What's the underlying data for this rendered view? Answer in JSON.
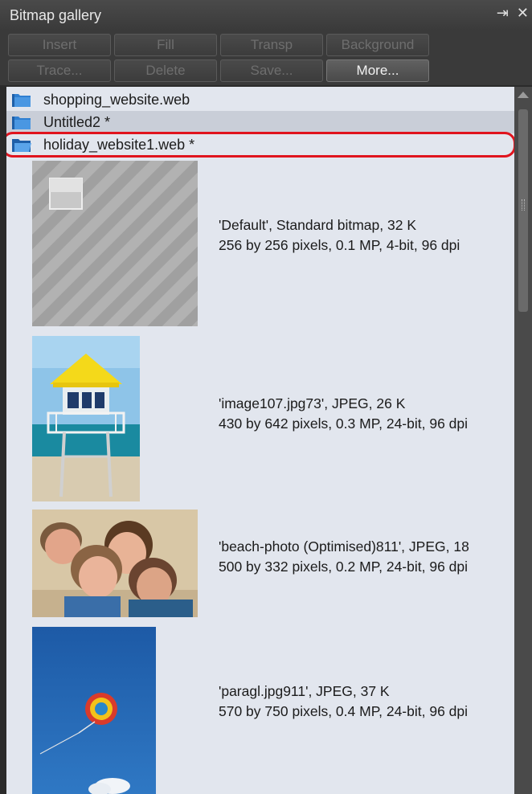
{
  "window": {
    "title": "Bitmap gallery"
  },
  "toolbar": {
    "row1": [
      "Insert",
      "Fill",
      "Transp",
      "Background"
    ],
    "row2": [
      "Trace...",
      "Delete",
      "Save...",
      "More..."
    ]
  },
  "folders": [
    {
      "name": "shopping_website.web"
    },
    {
      "name": "Untitled2 *"
    },
    {
      "name": "holiday_website1.web *"
    }
  ],
  "bitmaps": [
    {
      "line1": "'Default',  Standard bitmap,  32 K",
      "line2": "256 by 256 pixels, 0.1 MP, 4-bit,  96 dpi"
    },
    {
      "line1": "'image107.jpg73',  JPEG,  26 K",
      "line2": "430 by 642 pixels, 0.3 MP, 24-bit,  96 dpi"
    },
    {
      "line1": "'beach-photo (Optimised)811',  JPEG,  18",
      "line2": "500 by 332 pixels, 0.2 MP, 24-bit,  96 dpi"
    },
    {
      "line1": "'paragl.jpg911',  JPEG,  37 K",
      "line2": "570 by 750 pixels, 0.4 MP, 24-bit,  96 dpi"
    }
  ],
  "colors": {
    "highlight": "#e0141e",
    "folder": "#2f7fd1",
    "panel": "#e2e6ee"
  }
}
